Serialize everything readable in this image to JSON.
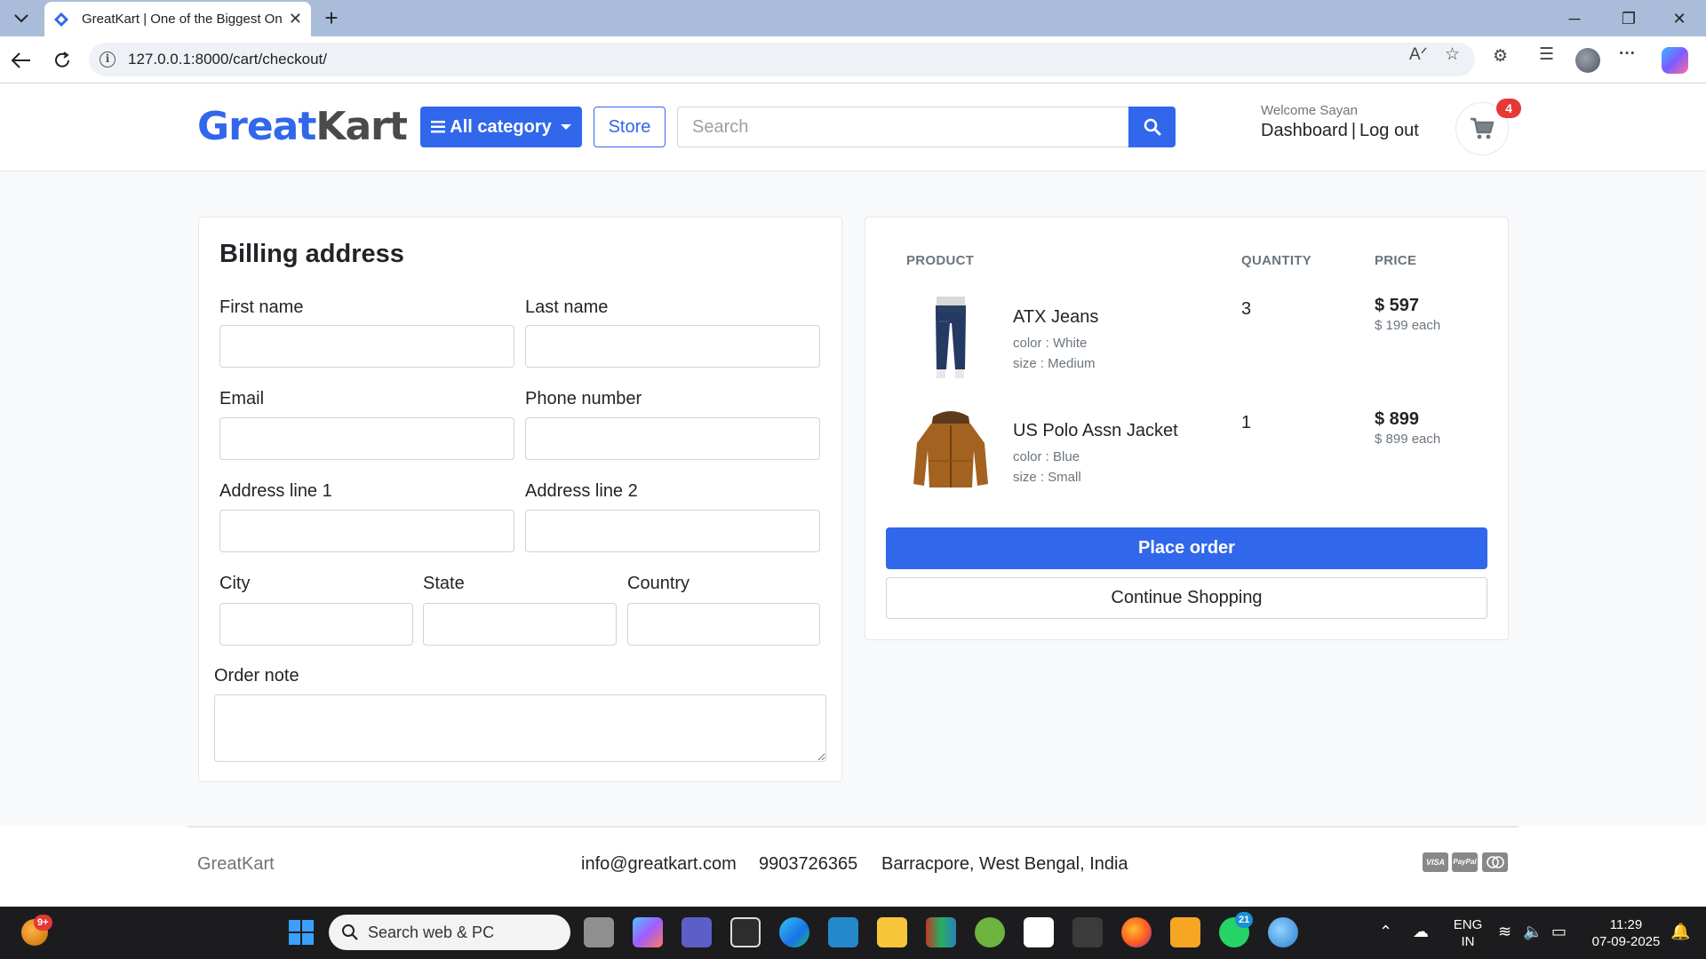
{
  "browser": {
    "tab_title": "GreatKart | One of the Biggest Online Shopping Website",
    "new_tab_icon": "plus-icon",
    "url": "127.0.0.1:8000/cart/checkout/"
  },
  "header": {
    "logo_part1": "Great",
    "logo_part2": "Kart",
    "category_label": "All category",
    "store_label": "Store",
    "search_placeholder": "Search",
    "search_value": "",
    "welcome": "Welcome Sayan",
    "dashboard_label": "Dashboard",
    "separator": "|",
    "logout_label": "Log out",
    "cart_count": "4"
  },
  "billing": {
    "title": "Billing address",
    "fields": {
      "first_name": {
        "label": "First name",
        "value": ""
      },
      "last_name": {
        "label": "Last name",
        "value": ""
      },
      "email": {
        "label": "Email",
        "value": ""
      },
      "phone": {
        "label": "Phone number",
        "value": ""
      },
      "address1": {
        "label": "Address line 1",
        "value": ""
      },
      "address2": {
        "label": "Address line 2",
        "value": ""
      },
      "city": {
        "label": "City",
        "value": ""
      },
      "state": {
        "label": "State",
        "value": ""
      },
      "country": {
        "label": "Country",
        "value": ""
      },
      "order_note": {
        "label": "Order note",
        "value": ""
      }
    }
  },
  "summary": {
    "columns": [
      "PRODUCT",
      "QUANTITY",
      "PRICE"
    ],
    "items": [
      {
        "name": "ATX Jeans",
        "color": "color : White",
        "size": "size : Medium",
        "quantity": "3",
        "total": "$ 597",
        "each": "$ 199 each"
      },
      {
        "name": "US Polo Assn Jacket",
        "color": "color : Blue",
        "size": "size : Small",
        "quantity": "1",
        "total": "$ 899",
        "each": "$ 899 each"
      }
    ],
    "place_order_label": "Place order",
    "continue_label": "Continue Shopping"
  },
  "footer": {
    "brand": "GreatKart",
    "email": "info@greatkart.com",
    "phone": "9903726365",
    "address": "Barracpore, West Bengal, India",
    "payment_icons": [
      "visa-icon",
      "paypal-icon",
      "mastercard-icon"
    ],
    "payment_text": [
      "VISA",
      "PayPal",
      ""
    ]
  },
  "taskbar": {
    "weather_badge": "9+",
    "search_text": "Search web & PC",
    "whatsapp_badge": "21",
    "lang_line1": "ENG",
    "lang_line2": "IN",
    "time": "11:29",
    "date": "07-09-2025"
  },
  "colors": {
    "brand_blue": "#3167eb",
    "badge_red": "#e53935"
  }
}
